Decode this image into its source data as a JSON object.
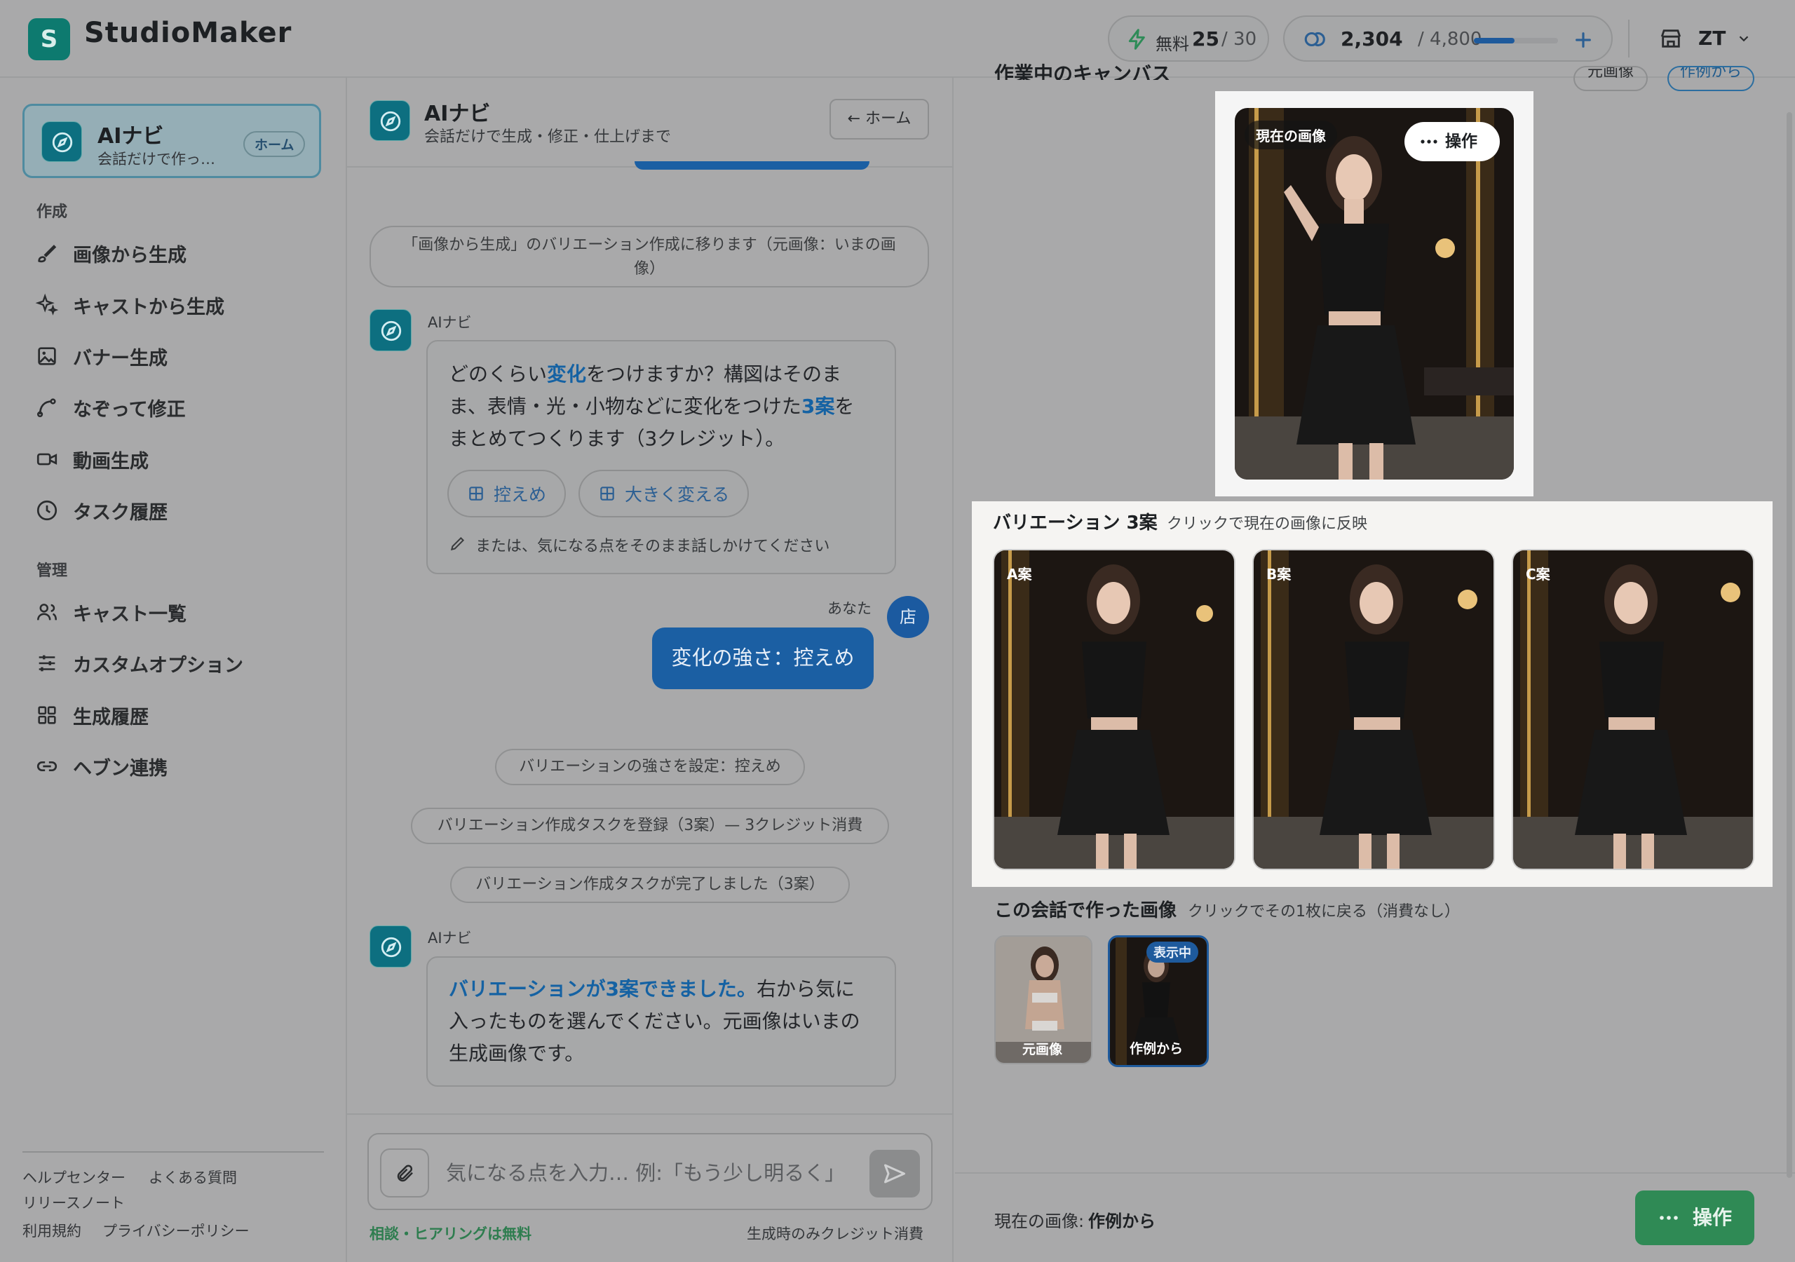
{
  "header": {
    "logo_letter": "S",
    "app_name": "StudioMaker",
    "free_label": "無料",
    "free_used": "25",
    "free_total": "/ 30",
    "credits_used": "2,304",
    "credits_total": "/ 4,800",
    "credits_fraction": 0.48,
    "user_initials": "ZT"
  },
  "sidebar": {
    "home": {
      "title": "AIナビ",
      "subtitle": "会話だけで作っ…",
      "badge": "ホーム"
    },
    "section_create": "作成",
    "create_items": [
      {
        "label": "画像から生成",
        "icon": "brush-icon"
      },
      {
        "label": "キャストから生成",
        "icon": "sparkle-icon"
      },
      {
        "label": "バナー生成",
        "icon": "image-icon"
      },
      {
        "label": "なぞって修正",
        "icon": "trace-icon"
      },
      {
        "label": "動画生成",
        "icon": "video-icon"
      },
      {
        "label": "タスク履歴",
        "icon": "clock-icon"
      }
    ],
    "section_manage": "管理",
    "manage_items": [
      {
        "label": "キャスト一覧",
        "icon": "users-icon"
      },
      {
        "label": "カスタムオプション",
        "icon": "sliders-icon"
      },
      {
        "label": "生成履歴",
        "icon": "grid-icon"
      },
      {
        "label": "ヘブン連携",
        "icon": "link-icon"
      }
    ],
    "footer": {
      "help": "ヘルプセンター",
      "faq": "よくある質問",
      "release": "リリースノート",
      "terms": "利用規約",
      "privacy": "プライバシーポリシー"
    }
  },
  "chat": {
    "title": "AIナビ",
    "subtitle": "会話だけで生成・修正・仕上げまで",
    "home_button": "← ホーム",
    "sys1_line1": "「画像から生成」のバリエーション作成に移ります（元画像：いまの画",
    "sys1_line2": "像）",
    "bot_name": "AIナビ",
    "msg1": {
      "p1": "どのくらい",
      "h1": "変化",
      "p2": "をつけますか？構図はそのま",
      "p3": "ま、表情・光・小物などに変化をつけた",
      "h2": "3案",
      "p4": "を",
      "p5": "まとめてつくります（3クレジット）。"
    },
    "chip_subtle": "控えめ",
    "chip_big": "大きく変える",
    "hint": "または、気になる点をそのまま話しかけてください",
    "user_name": "あなた",
    "user_avatar": "店",
    "user_msg": "変化の強さ：控えめ",
    "sys2": "バリエーションの強さを設定：控えめ",
    "sys3": "バリエーション作成タスクを登録（3案）— 3クレジット消費",
    "sys4": "バリエーション作成タスクが完了しました（3案）",
    "msg2": {
      "h1": "バリエーションが3案できました。",
      "p1": "右から気に",
      "p2": "入ったものを選んでください。元画像はいまの",
      "p3": "生成画像です。"
    },
    "input_placeholder": "気になる点を入力… 例:「もう少し明るく」",
    "free_note": "相談・ヒアリングは無料",
    "credit_note": "生成時のみクレジット消費"
  },
  "right": {
    "partial_title": "作業中のキャンバス",
    "tab_original": "元画像",
    "tab_example": "作例から",
    "current_badge": "現在の画像",
    "ops_label": "操作",
    "variations_title": "バリエーション 3案",
    "variations_hint": "クリックで現在の画像に反映",
    "variants": [
      "A案",
      "B案",
      "C案"
    ],
    "history_title": "この会話で作った画像",
    "history_hint": "クリックでその1枚に戻る（消費なし）",
    "history": [
      {
        "label": "元画像",
        "badge": ""
      },
      {
        "label": "作例から",
        "badge": "表示中"
      }
    ],
    "footer_current_label": "現在の画像:",
    "footer_current_value": "作例から",
    "footer_ops": "操作"
  }
}
